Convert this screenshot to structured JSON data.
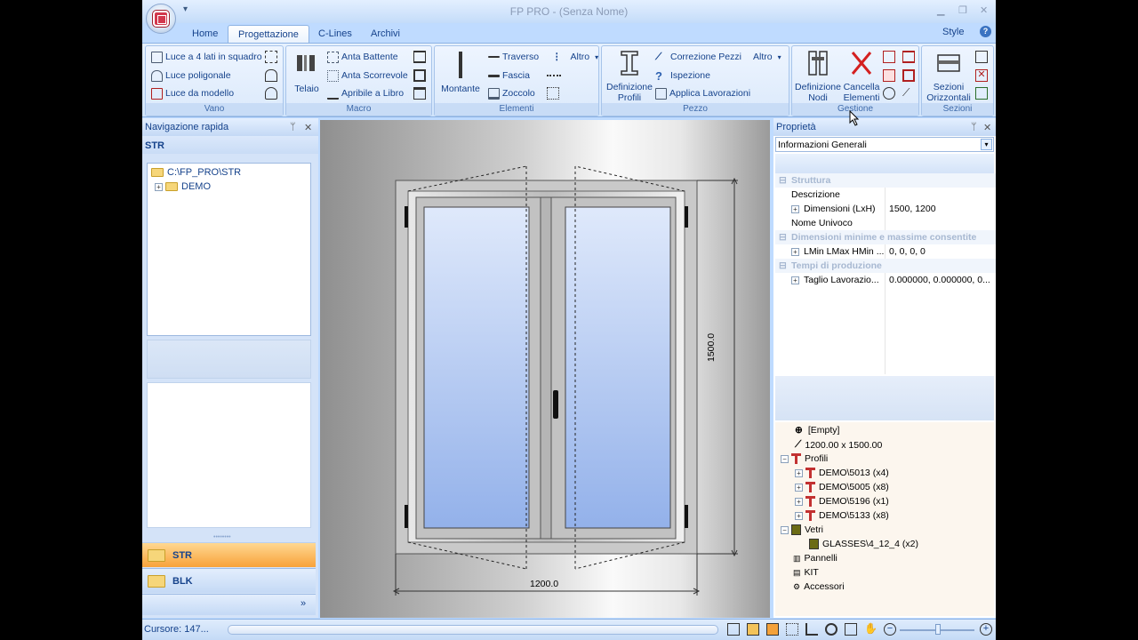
{
  "window": {
    "title": "FP PRO - (Senza Nome)",
    "style_label": "Style",
    "help": "?",
    "min": "▁",
    "restore": "❐",
    "close": "✕",
    "qat": "▾"
  },
  "tabs": [
    {
      "label": "Home"
    },
    {
      "label": "Progettazione"
    },
    {
      "label": "C-Lines"
    },
    {
      "label": "Archivi"
    }
  ],
  "ribbon": {
    "vano": {
      "label": "Vano",
      "items": [
        "Luce a 4 lati in squadro",
        "Luce poligonale",
        "Luce da modello"
      ]
    },
    "macro": {
      "label": "Macro",
      "telaio": "Telaio",
      "items": [
        "Anta Battente",
        "Anta Scorrevole",
        "Apribile a Libro"
      ]
    },
    "elementi": {
      "label": "Elementi",
      "montante": "Montante",
      "items": [
        "Traverso",
        "Fascia",
        "Zoccolo"
      ],
      "altro": "Altro"
    },
    "pezzo": {
      "label": "Pezzo",
      "def1": "Definizione",
      "def2": "Profili",
      "items": [
        "Correzione Pezzi",
        "Ispezione",
        "Applica Lavorazioni"
      ],
      "altro": "Altro"
    },
    "gestione": {
      "label": "Gestione",
      "defnodi1": "Definizione",
      "defnodi2": "Nodi",
      "canc1": "Cancella",
      "canc2": "Elementi"
    },
    "sezioni": {
      "label": "Sezioni",
      "sez1": "Sezioni",
      "sez2": "Orizzontali"
    }
  },
  "nav": {
    "title": "Navigazione rapida",
    "current": "STR",
    "tree": [
      "C:\\FP_PRO\\STR",
      "DEMO"
    ],
    "buttons": [
      "STR",
      "BLK"
    ],
    "pin": "ᛘ",
    "close": "✕",
    "grip": "••••••••",
    "more": "»"
  },
  "drawing": {
    "width_dim": "1200.0",
    "height_dim": "1500.0"
  },
  "props": {
    "title": "Proprietà",
    "selector": "Informazioni Generali",
    "cat1": "Struttura",
    "descr": "Descrizione",
    "dim_name": "Dimensioni (LxH)",
    "dim_val": "1500, 1200",
    "nome": "Nome Univoco",
    "cat2": "Dimensioni minime e massime consentite",
    "lmin_name": "LMin LMax HMin ...",
    "lmin_val": "0, 0, 0, 0",
    "cat3": "Tempi di produzione",
    "taglio_name": "Taglio Lavorazio...",
    "taglio_val": "0.000000, 0.000000, 0..."
  },
  "tree2": {
    "empty": "[Empty]",
    "size": "1200.00 x 1500.00",
    "profili": "Profili",
    "prof_items": [
      "DEMO\\5013 (x4)",
      "DEMO\\5005 (x8)",
      "DEMO\\5196 (x1)",
      "DEMO\\5133 (x8)"
    ],
    "vetri": "Vetri",
    "glass": "GLASSES\\4_12_4 (x2)",
    "pannelli": "Pannelli",
    "kit": "KIT",
    "accessori": "Accessori"
  },
  "status": {
    "cursor": "Cursore:  147..."
  }
}
